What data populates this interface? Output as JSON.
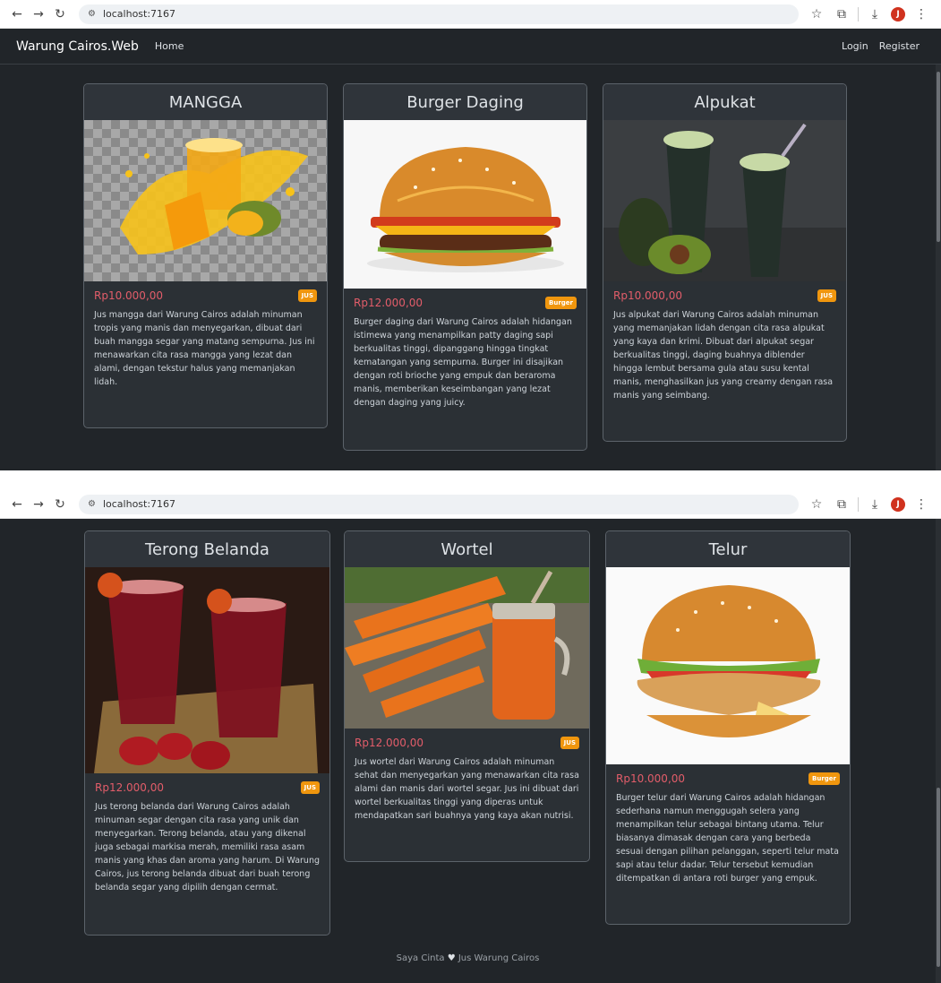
{
  "browser": {
    "url": "localhost:7167",
    "back_icon": "arrow-left-icon",
    "forward_icon": "arrow-right-icon",
    "reload_icon": "reload-icon",
    "profile_initial": "J"
  },
  "navbar": {
    "brand": "Warung Cairos.Web",
    "home": "Home",
    "login": "Login",
    "register": "Register"
  },
  "products_row1": [
    {
      "title": "MANGGA",
      "price": "Rp10.000,00",
      "badge": "JUS",
      "desc": "Jus mangga dari Warung Cairos adalah minuman tropis yang manis dan menyegarkan, dibuat dari buah mangga segar yang matang sempurna. Jus ini menawarkan cita rasa mangga yang lezat dan alami, dengan tekstur halus yang memanjakan lidah."
    },
    {
      "title": "Burger Daging",
      "price": "Rp12.000,00",
      "badge": "Burger",
      "desc": "Burger daging dari Warung Cairos adalah hidangan istimewa yang menampilkan patty daging sapi berkualitas tinggi, dipanggang hingga tingkat kematangan yang sempurna. Burger ini disajikan dengan roti brioche yang empuk dan beraroma manis, memberikan keseimbangan yang lezat dengan daging yang juicy."
    },
    {
      "title": "Alpukat",
      "price": "Rp10.000,00",
      "badge": "JUS",
      "desc": "Jus alpukat dari Warung Cairos adalah minuman yang memanjakan lidah dengan cita rasa alpukat yang kaya dan krimi. Dibuat dari alpukat segar berkualitas tinggi, daging buahnya diblender hingga lembut bersama gula atau susu kental manis, menghasilkan jus yang creamy dengan rasa manis yang seimbang."
    }
  ],
  "products_row2": [
    {
      "title": "Terong Belanda",
      "price": "Rp12.000,00",
      "badge": "JUS",
      "desc": "Jus terong belanda dari Warung Cairos adalah minuman segar dengan cita rasa yang unik dan menyegarkan. Terong belanda, atau yang dikenal juga sebagai markisa merah, memiliki rasa asam manis yang khas dan aroma yang harum. Di Warung Cairos, jus terong belanda dibuat dari buah terong belanda segar yang dipilih dengan cermat."
    },
    {
      "title": "Wortel",
      "price": "Rp12.000,00",
      "badge": "JUS",
      "desc": "Jus wortel dari Warung Cairos adalah minuman sehat dan menyegarkan yang menawarkan cita rasa alami dan manis dari wortel segar. Jus ini dibuat dari wortel berkualitas tinggi yang diperas untuk mendapatkan sari buahnya yang kaya akan nutrisi."
    },
    {
      "title": "Telur",
      "price": "Rp10.000,00",
      "badge": "Burger",
      "desc": "Burger telur dari Warung Cairos adalah hidangan sederhana namun menggugah selera yang menampilkan telur sebagai bintang utama. Telur biasanya dimasak dengan cara yang berbeda sesuai dengan pilihan pelanggan, seperti telur mata sapi atau telur dadar. Telur tersebut kemudian ditempatkan di antara roti burger yang empuk."
    }
  ],
  "footer": {
    "before": "Saya Cinta",
    "after": "Jus Warung Cairos",
    "icon": "heart-icon"
  }
}
